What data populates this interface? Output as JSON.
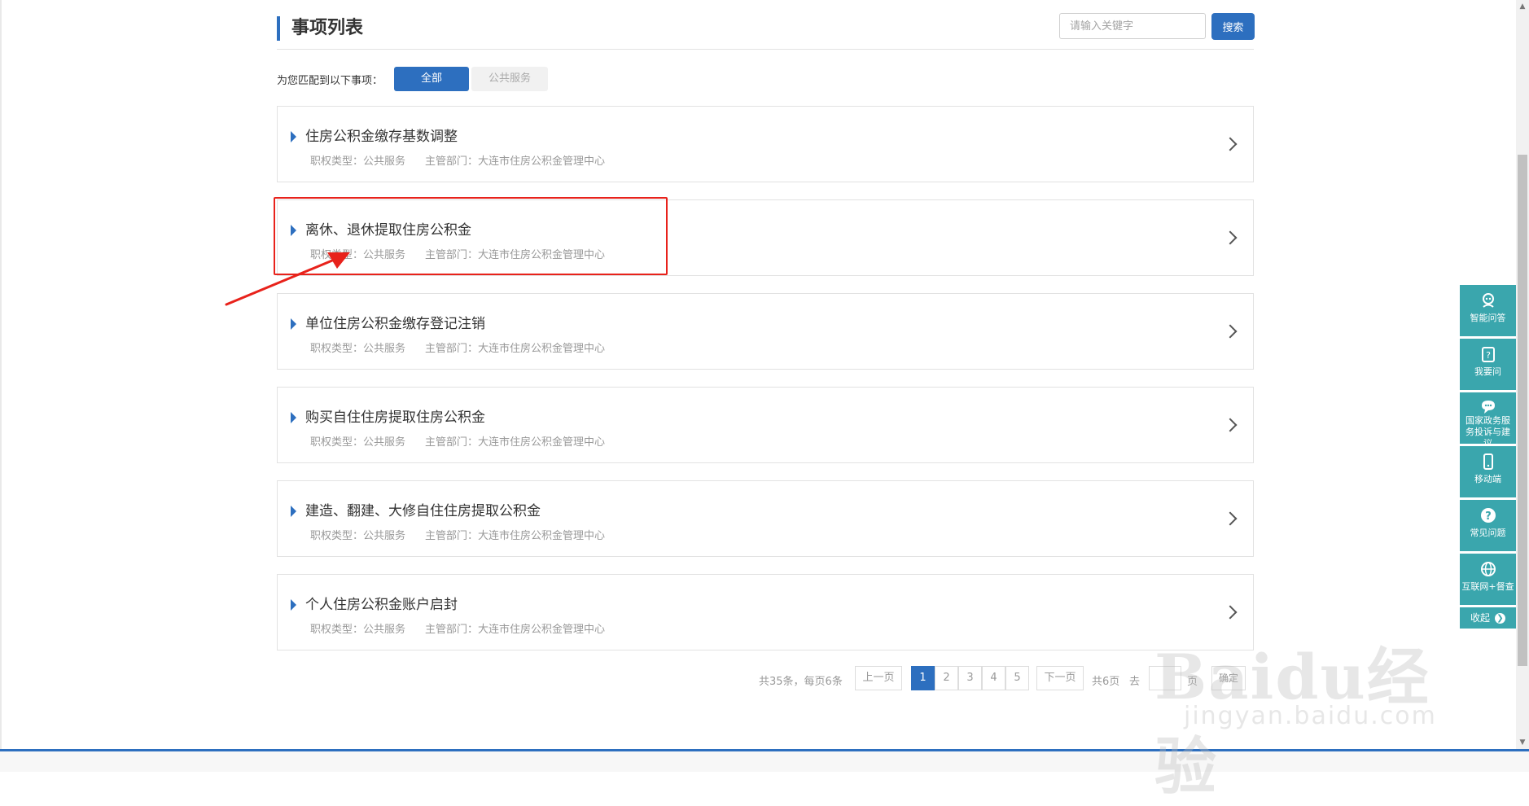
{
  "header": {
    "title": "事项列表"
  },
  "search": {
    "placeholder": "请输入关键字",
    "button_label": "搜索"
  },
  "filter": {
    "label": "为您匹配到以下事项：",
    "tabs": [
      "全部",
      "公共服务"
    ]
  },
  "items": [
    {
      "title": "住房公积金缴存基数调整",
      "type": "职权类型：公共服务",
      "dept": "主管部门：大连市住房公积金管理中心"
    },
    {
      "title": "离休、退休提取住房公积金",
      "type": "职权类型：公共服务",
      "dept": "主管部门：大连市住房公积金管理中心"
    },
    {
      "title": "单位住房公积金缴存登记注销",
      "type": "职权类型：公共服务",
      "dept": "主管部门：大连市住房公积金管理中心"
    },
    {
      "title": "购买自住住房提取住房公积金",
      "type": "职权类型：公共服务",
      "dept": "主管部门：大连市住房公积金管理中心"
    },
    {
      "title": "建造、翻建、大修自住住房提取公积金",
      "type": "职权类型：公共服务",
      "dept": "主管部门：大连市住房公积金管理中心"
    },
    {
      "title": "个人住房公积金账户启封",
      "type": "职权类型：公共服务",
      "dept": "主管部门：大连市住房公积金管理中心"
    }
  ],
  "pagination": {
    "total_text": "共35条，每页6条",
    "prev_label": "上一页",
    "pages": [
      "1",
      "2",
      "3",
      "4",
      "5"
    ],
    "next_label": "下一页",
    "pages_text": "共6页",
    "goto_label": "去",
    "unit_label": "页",
    "confirm_label": "确定"
  },
  "side_toolbar": {
    "items": [
      {
        "label": "智能问答",
        "icon": "robot-icon"
      },
      {
        "label": "我要问",
        "icon": "question-clipboard-icon"
      },
      {
        "label": "国家政务服务投诉与建议",
        "icon": "chat-bubble-icon"
      },
      {
        "label": "移动端",
        "icon": "mobile-phone-icon"
      },
      {
        "label": "常见问题",
        "icon": "question-circle-icon"
      },
      {
        "label": "互联网+督查",
        "icon": "globe-icon"
      }
    ],
    "collapse_label": "收起"
  },
  "watermark": {
    "brand": "Baidu经验",
    "url": "jingyan.baidu.com"
  },
  "colors": {
    "primary": "#2d6fbf",
    "highlight": "#e8221b",
    "toolbar": "#3aa6ad"
  }
}
